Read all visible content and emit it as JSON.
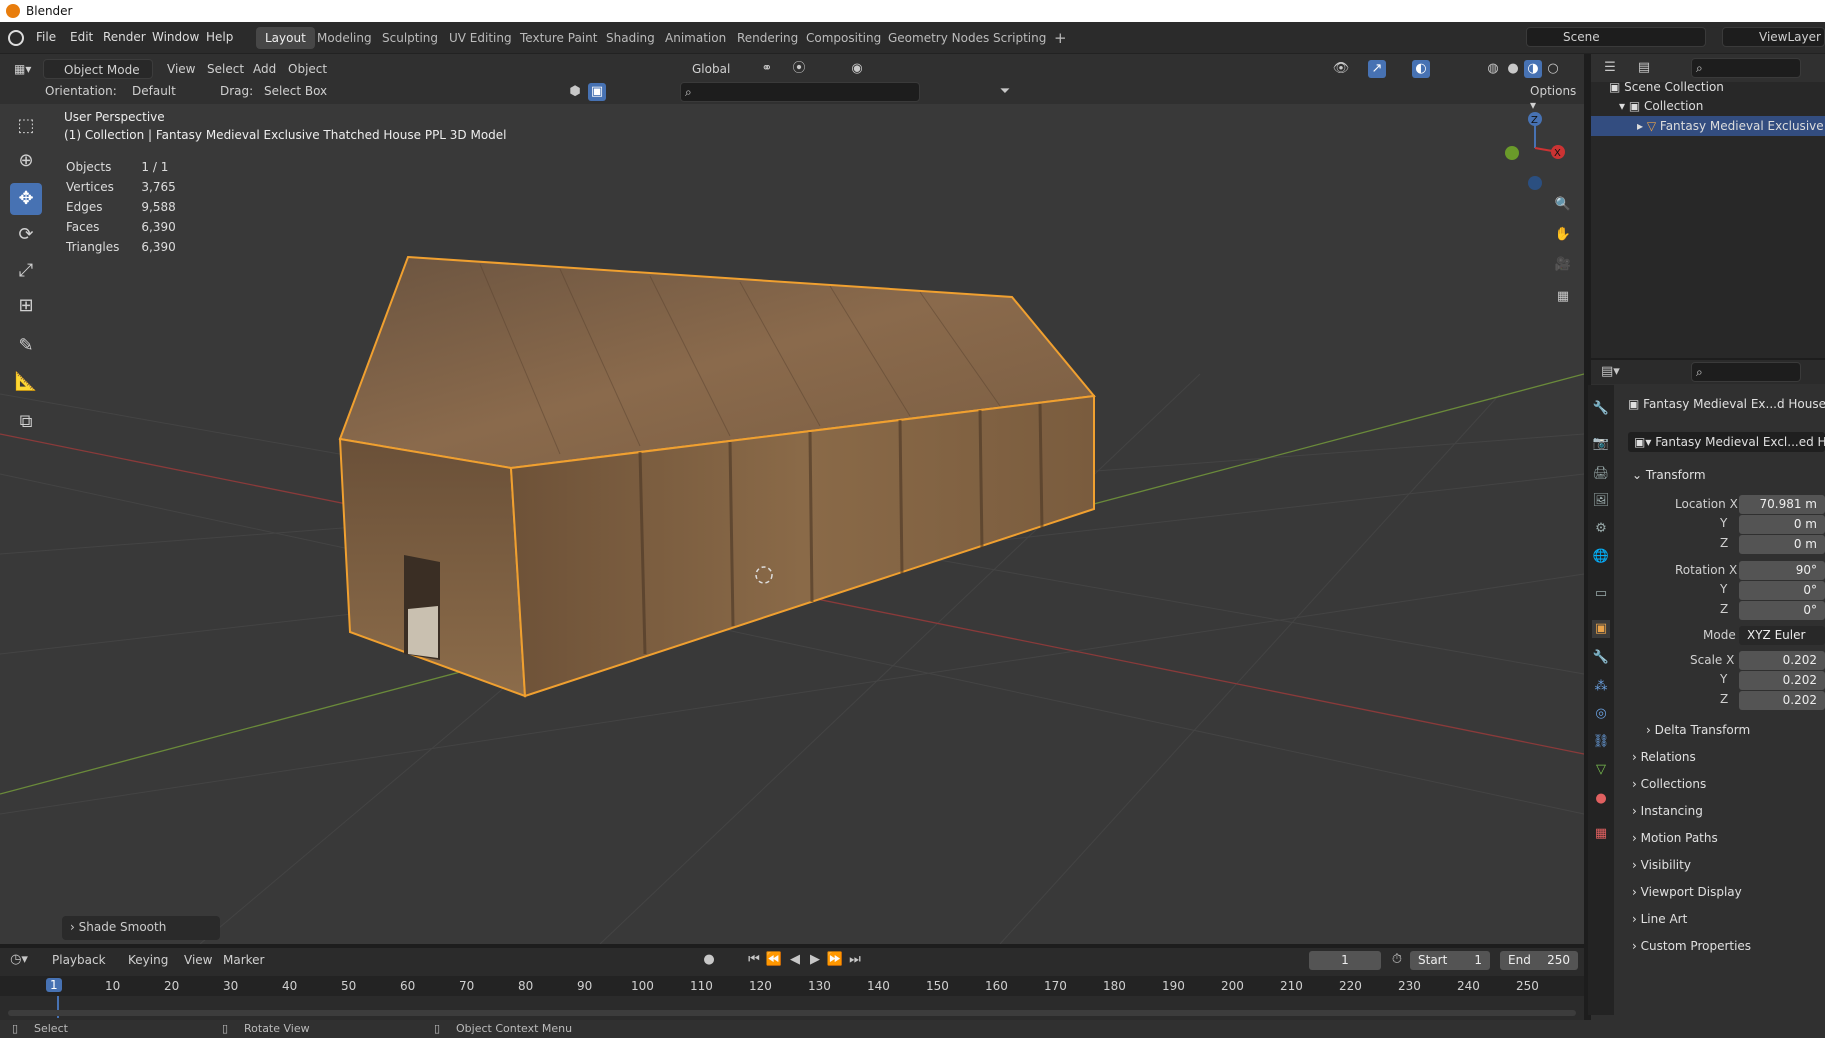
{
  "window": {
    "title": "Blender"
  },
  "menu": [
    "File",
    "Edit",
    "Render",
    "Window",
    "Help"
  ],
  "workspaces": [
    "Layout",
    "Modeling",
    "Sculpting",
    "UV Editing",
    "Texture Paint",
    "Shading",
    "Animation",
    "Rendering",
    "Compositing",
    "Geometry Nodes",
    "Scripting"
  ],
  "active_workspace": "Layout",
  "scene": {
    "label": "Scene",
    "view_layer": "ViewLayer"
  },
  "header": {
    "mode": "Object Mode",
    "menus": [
      "View",
      "Select",
      "Add",
      "Object"
    ],
    "transform_orientation": "Global",
    "orientation_label": "Orientation:",
    "orientation_value": "Default",
    "drag_label": "Drag:",
    "drag_value": "Select Box",
    "options": "Options"
  },
  "viewport": {
    "perspective": "User Perspective",
    "collection_line": "(1) Collection | Fantasy Medieval Exclusive Thatched House PPL 3D Model",
    "stats": [
      {
        "label": "Objects",
        "value": "1 / 1"
      },
      {
        "label": "Vertices",
        "value": "3,765"
      },
      {
        "label": "Edges",
        "value": "9,588"
      },
      {
        "label": "Faces",
        "value": "6,390"
      },
      {
        "label": "Triangles",
        "value": "6,390"
      }
    ],
    "last_op": "Shade Smooth",
    "gizmo": {
      "z": "Z",
      "x": "X"
    }
  },
  "outliner": {
    "scene_collection": "Scene Collection",
    "collection": "Collection",
    "object": "Fantasy Medieval Exclusive Th"
  },
  "properties": {
    "object_name": "Fantasy Medieval Ex...d House PPL",
    "mesh_name": "Fantasy Medieval Excl...ed Hous",
    "transform_title": "Transform",
    "location": {
      "label": "Location X",
      "x": "70.981 m",
      "y": "0 m",
      "z": "0 m"
    },
    "rotation": {
      "label": "Rotation X",
      "x": "90°",
      "y": "0°",
      "z": "0°"
    },
    "mode_label": "Mode",
    "mode_value": "XYZ Euler",
    "scale": {
      "label": "Scale X",
      "x": "0.202",
      "y": "0.202",
      "z": "0.202"
    },
    "axis_y": "Y",
    "axis_z": "Z",
    "delta": "Delta Transform",
    "sections": [
      "Relations",
      "Collections",
      "Instancing",
      "Motion Paths",
      "Visibility",
      "Viewport Display",
      "Line Art",
      "Custom Properties"
    ]
  },
  "timeline": {
    "menus": [
      "Playback",
      "Keying",
      "View",
      "Marker"
    ],
    "current_frame": "1",
    "start_label": "Start",
    "start": "1",
    "end_label": "End",
    "end": "250",
    "ruler": [
      "1",
      "10",
      "20",
      "30",
      "40",
      "50",
      "60",
      "70",
      "80",
      "90",
      "100",
      "110",
      "120",
      "130",
      "140",
      "150",
      "160",
      "170",
      "180",
      "190",
      "200",
      "210",
      "220",
      "230",
      "240",
      "250"
    ]
  },
  "statusbar": {
    "select": "Select",
    "rotate": "Rotate View",
    "context": "Object Context Menu"
  }
}
